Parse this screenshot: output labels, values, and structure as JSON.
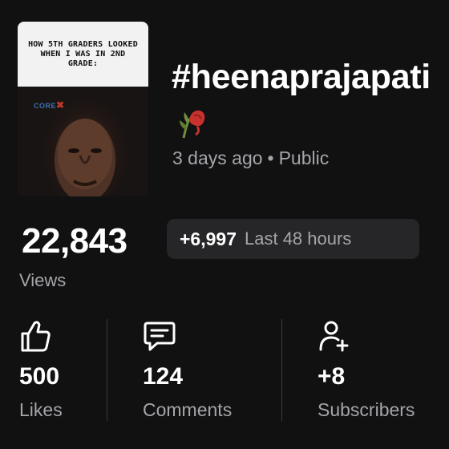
{
  "thumbnail": {
    "caption": "HOW 5TH GRADERS LOOKED WHEN I WAS IN 2ND GRADE:",
    "watermark": "CORE"
  },
  "video": {
    "title": "#heenaprajapati",
    "title_emoji_icon": "wilted-rose-icon",
    "posted": "3 days ago",
    "separator": "•",
    "visibility": "Public"
  },
  "views": {
    "count": "22,843",
    "label": "Views",
    "recent_delta": "+6,997",
    "recent_window": "Last 48 hours"
  },
  "stats": {
    "likes": {
      "value": "500",
      "label": "Likes",
      "icon": "thumbs-up-icon"
    },
    "comments": {
      "value": "124",
      "label": "Comments",
      "icon": "comment-icon"
    },
    "subscribers": {
      "value": "+8",
      "label": "Subscribers",
      "icon": "add-person-icon"
    }
  },
  "colors": {
    "background": "#111112",
    "pill": "#262628",
    "secondary_text": "#a5a5aa",
    "divider": "#3a3a3d"
  }
}
